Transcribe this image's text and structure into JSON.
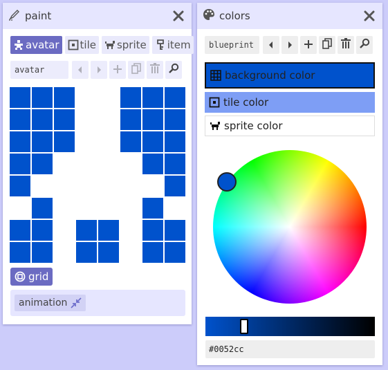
{
  "paint": {
    "title": "paint",
    "tabs": [
      {
        "label": "avatar",
        "icon": "avatar-icon",
        "active": true
      },
      {
        "label": "tile",
        "icon": "tile-icon",
        "active": false
      },
      {
        "label": "sprite",
        "icon": "sprite-icon",
        "active": false
      },
      {
        "label": "item",
        "icon": "item-icon",
        "active": false
      }
    ],
    "name_value": "avatar",
    "toolbar_icons": [
      "arrow-left-icon",
      "arrow-right-icon",
      "plus-icon",
      "copy-icon",
      "trash-icon",
      "search-icon"
    ],
    "pixel_color": "#0052cc",
    "pixels": [
      [
        1,
        1,
        1,
        0,
        0,
        1,
        1,
        1
      ],
      [
        1,
        1,
        1,
        0,
        0,
        1,
        1,
        1
      ],
      [
        1,
        1,
        1,
        0,
        0,
        1,
        1,
        1
      ],
      [
        1,
        1,
        0,
        0,
        0,
        0,
        1,
        1
      ],
      [
        1,
        0,
        0,
        0,
        0,
        0,
        0,
        1
      ],
      [
        0,
        1,
        0,
        0,
        0,
        0,
        1,
        0
      ],
      [
        1,
        1,
        0,
        1,
        1,
        0,
        1,
        1
      ],
      [
        1,
        1,
        0,
        1,
        1,
        0,
        1,
        1
      ]
    ],
    "grid_label": "grid",
    "animation_label": "animation"
  },
  "colors": {
    "title": "colors",
    "name_value": "blueprint",
    "toolbar_icons": [
      "arrow-left-icon",
      "arrow-right-icon",
      "plus-icon",
      "copy-icon",
      "trash-icon",
      "search-icon"
    ],
    "rows": {
      "background": "background color",
      "tile": "tile color",
      "sprite": "sprite color"
    },
    "hex_value": "#0052cc",
    "accent": "#0052cc",
    "selected_row_tint": "#7e9ef5"
  }
}
